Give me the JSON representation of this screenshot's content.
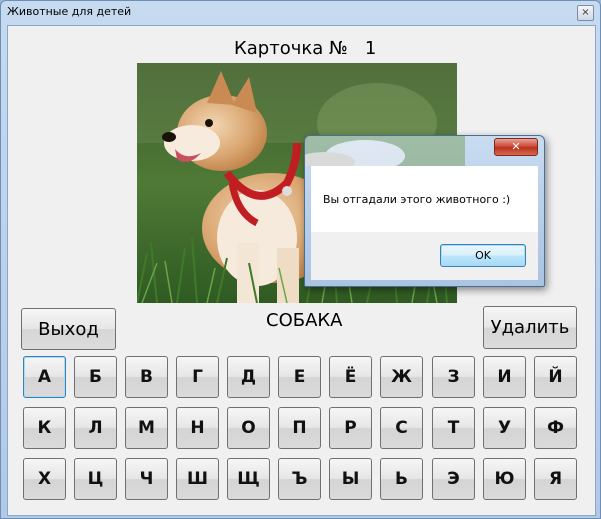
{
  "window": {
    "title": "Животные для детей",
    "close_glyph": "×"
  },
  "card": {
    "title": "Карточка №   1",
    "answer": "СОБАКА",
    "image": "shiba-inu-dog-photo"
  },
  "buttons": {
    "exit_label": "Выход",
    "delete_label": "Удалить"
  },
  "keyboard": {
    "row1": [
      "А",
      "Б",
      "В",
      "Г",
      "Д",
      "Е",
      "Ё",
      "Ж",
      "З",
      "И",
      "Й"
    ],
    "row2": [
      "К",
      "Л",
      "М",
      "Н",
      "О",
      "П",
      "Р",
      "С",
      "Т",
      "У",
      "Ф"
    ],
    "row3": [
      "Х",
      "Ц",
      "Ч",
      "Ш",
      "Щ",
      "Ъ",
      "Ы",
      "Ь",
      "Э",
      "Ю",
      "Я"
    ],
    "focused_key": "А"
  },
  "dialog": {
    "close_glyph": "✕",
    "message": "Вы отгадали этого животного :)",
    "ok_label": "OK"
  }
}
